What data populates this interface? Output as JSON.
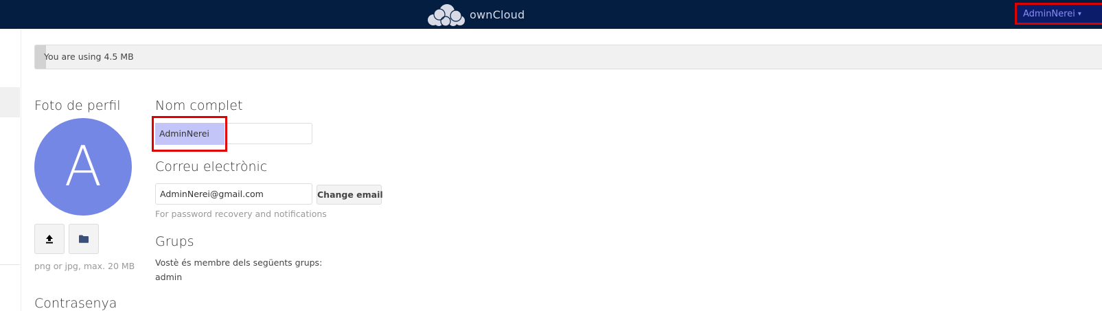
{
  "header": {
    "brand": "ownCloud",
    "user_name": "AdminNerei",
    "caret": "▾",
    "colors": {
      "background": "#041e42",
      "user_menu_text": "#8a8cf4",
      "highlight": "#e00000"
    }
  },
  "quota": {
    "text": "You are using 4.5 MB",
    "fill_fraction": 0.01
  },
  "profile_photo": {
    "heading": "Foto de perfil",
    "avatar_letter": "A",
    "avatar_color": "#7587e5",
    "upload_icon": "upload-icon",
    "folder_icon": "folder-icon",
    "hint": "png or jpg, max. 20 MB"
  },
  "full_name": {
    "heading": "Nom complet",
    "value": "AdminNerei"
  },
  "email": {
    "heading": "Correu electrònic",
    "value": "AdminNerei@gmail.com",
    "change_button": "Change email",
    "hint": "For password recovery and notifications"
  },
  "groups": {
    "heading": "Grups",
    "member_text": "Vostè és membre dels següents grups:",
    "list": "admin"
  },
  "password": {
    "heading": "Contrasenya"
  }
}
